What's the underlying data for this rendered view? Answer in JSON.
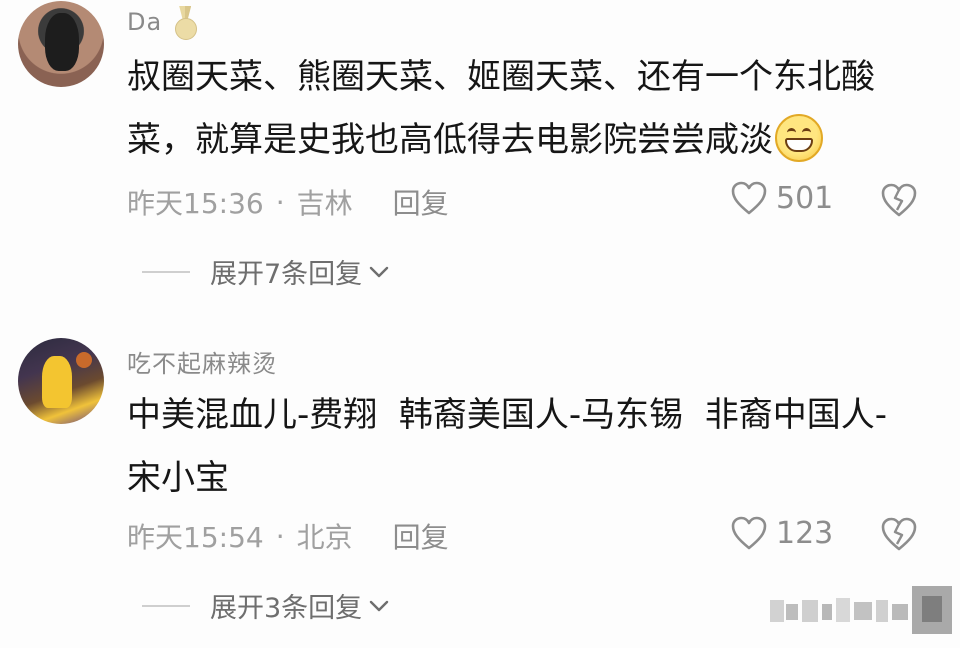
{
  "comments": [
    {
      "username": "Da",
      "text": "叔圈天菜、熊圈天菜、姬圈天菜、还有一个东北酸菜，就算是史我也高低得去电影院尝尝咸淡",
      "time": "昨天15:36",
      "location": "吉林",
      "reply_label": "回复",
      "likes": "501",
      "expand_label": "展开7条回复"
    },
    {
      "username": "吃不起麻辣烫",
      "text": "中美混血儿-费翔  韩裔美国人-马东锡  非裔中国人-宋小宝",
      "time": "昨天15:54",
      "location": "北京",
      "reply_label": "回复",
      "likes": "123",
      "expand_label": "展开3条回复"
    }
  ],
  "icons": {
    "medal": "medal-icon",
    "emoji": "grinning-emoji-icon",
    "like": "heart-icon",
    "dislike": "broken-heart-icon",
    "expand": "chevron-down-icon"
  },
  "colors": {
    "text": "#161616",
    "secondary": "#a0a0a0",
    "background": "#fdfdfd"
  }
}
